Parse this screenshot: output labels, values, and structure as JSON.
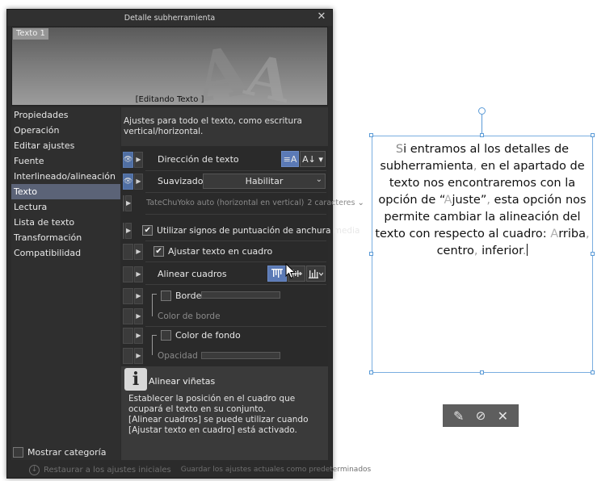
{
  "dialog": {
    "title": "Detalle subherramienta",
    "close_icon": "close-icon",
    "preview": {
      "tag": "Texto 1",
      "editing_label": "[Editando Texto ]"
    },
    "sidebar": {
      "items": [
        {
          "label": "Propiedades"
        },
        {
          "label": "Operación"
        },
        {
          "label": "Editar ajustes"
        },
        {
          "label": "Fuente"
        },
        {
          "label": "Interlineado/alineación"
        },
        {
          "label": "Texto"
        },
        {
          "label": "Lectura"
        },
        {
          "label": "Lista de texto"
        },
        {
          "label": "Transformación"
        },
        {
          "label": "Compatibilidad"
        }
      ],
      "active_index": 5,
      "show_category_label": "Mostrar categoría"
    },
    "main": {
      "description": "Ajustes para todo el texto, como escritura vertical/horizontal.",
      "text_direction_label": "Dirección de texto",
      "antialias_label": "Suavizado",
      "antialias_value": "Habilitar",
      "tatechuyoko_label": "TateChuYoko auto (horizontal en vertical)",
      "tatechuyoko_value": "2 caracteres",
      "fullwidth_punct_label": "Utilizar signos de puntuación de anchura media",
      "fit_text_label": "Ajustar texto en cuadro",
      "align_boxes_label": "Alinear cuadros",
      "border_label": "Borde",
      "border_color_label": "Color de borde",
      "bg_color_label": "Color de fondo",
      "opacity_label": "Opacidad"
    },
    "info": {
      "title": "Alinear viñetas",
      "line1": "Establecer la posición en el cuadro que ocupará el texto en su conjunto.",
      "line2": "[Alinear cuadros] se puede utilizar cuando [Ajustar texto en cuadro] está activado."
    },
    "footer": {
      "reset_label": "Restaurar a los ajustes iniciales",
      "save_default_label": "Guardar los ajustes actuales como predeterminados"
    }
  },
  "canvas": {
    "text_first_letter": "S",
    "text_part1": "i entramos al los detalles de subherramienta",
    "text_comma1": ",",
    "text_part2": " en el apartado de texto nos encontraremos con la opción de “",
    "text_letter_a": "A",
    "text_part3": "juste”",
    "text_comma2": ",",
    "text_part4": " esta opción nos permite cambiar la alineación del texto con respecto al cuadro: ",
    "text_letter_a2": "A",
    "text_part5": "rriba",
    "text_comma3": ",",
    "text_part6": " centro",
    "text_comma4": ",",
    "text_part7": " inferior",
    "text_period": "."
  },
  "colors": {
    "dialog_bg": "#2b2b2b",
    "active_item": "#5b6377",
    "accent_blue": "#5b7ab6",
    "selection_border": "#7aaee0"
  }
}
